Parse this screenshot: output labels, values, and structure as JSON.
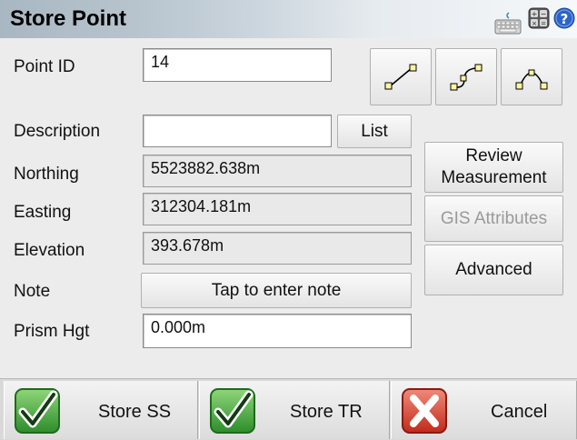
{
  "window": {
    "title": "Store Point"
  },
  "toolbar_icons": [
    "keyboard-icon",
    "calculator-icon",
    "help-icon"
  ],
  "form": {
    "point_id": {
      "label": "Point ID",
      "value": "14"
    },
    "description": {
      "label": "Description",
      "value": "",
      "list_button": "List"
    },
    "northing": {
      "label": "Northing",
      "value": "5523882.638m"
    },
    "easting": {
      "label": "Easting",
      "value": "312304.181m"
    },
    "elevation": {
      "label": "Elevation",
      "value": "393.678m"
    },
    "note": {
      "label": "Note",
      "button": "Tap to enter note"
    },
    "prism_hgt": {
      "label": "Prism Hgt",
      "value": "0.000m"
    }
  },
  "side_buttons": {
    "review_line1": "Review",
    "review_line2": "Measurement",
    "gis": "GIS Attributes",
    "advanced": "Advanced"
  },
  "geometry_buttons": [
    "line-icon",
    "curve-icon",
    "arc-icon"
  ],
  "bottom_bar": {
    "store_ss": "Store SS",
    "store_tr": "Store TR",
    "cancel": "Cancel"
  }
}
